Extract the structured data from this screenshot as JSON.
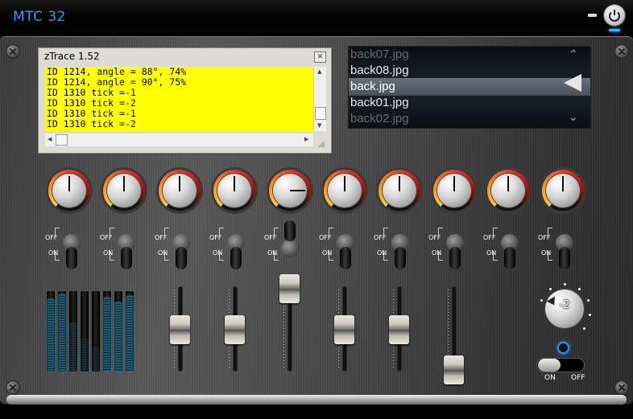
{
  "app": {
    "title": "MTC 32"
  },
  "ztrace": {
    "title": "zTrace 1.52",
    "lines": [
      "ID 1214, angle = 88°, 74%",
      "ID 1214, angle = 90°, 75%",
      "ID 1310 tick =-1",
      "ID 1310 tick =-2",
      "ID 1310 tick =-1",
      "ID 1310 tick =-2"
    ]
  },
  "filelist": {
    "items": [
      "back07.jpg",
      "back08.jpg",
      "back.jpg",
      "back01.jpg",
      "back02.jpg"
    ],
    "selected_index": 2
  },
  "toggles": {
    "off_label": "OFF",
    "on_label": "ON"
  },
  "rotary": {
    "value": "-2"
  },
  "onoff_switch": {
    "on_label": "ON",
    "off_label": "OFF"
  },
  "colors": {
    "title": "#2f9bea",
    "trace_bg": "#ffff00",
    "led": "#2c8bff",
    "meter": "#2aa7d8"
  },
  "icons": {
    "power": "power-icon",
    "minimize": "minimize-icon",
    "close": "close-icon"
  }
}
